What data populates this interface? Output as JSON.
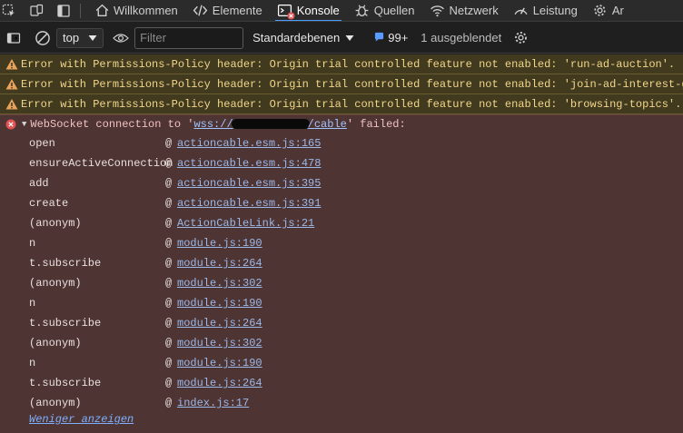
{
  "tabs": [
    {
      "label": "Willkommen",
      "icon": "home-icon"
    },
    {
      "label": "Elemente",
      "icon": "code-icon"
    },
    {
      "label": "Konsole",
      "icon": "console-icon",
      "active": true
    },
    {
      "label": "Quellen",
      "icon": "bug-icon"
    },
    {
      "label": "Netzwerk",
      "icon": "wifi-icon"
    },
    {
      "label": "Leistung",
      "icon": "performance-icon"
    },
    {
      "label": "Ar",
      "icon": "gear-icon"
    }
  ],
  "toolbar": {
    "context": "top",
    "filter_placeholder": "Filter",
    "levels": "Standardebenen",
    "issues_count": "99+",
    "hidden": "1 ausgeblendet"
  },
  "warnings": [
    "Error with Permissions-Policy header: Origin trial controlled feature not enabled: 'run-ad-auction'.",
    "Error with Permissions-Policy header: Origin trial controlled feature not enabled: 'join-ad-interest-group'.",
    "Error with Permissions-Policy header: Origin trial controlled feature not enabled: 'browsing-topics'."
  ],
  "error": {
    "prefix": "WebSocket connection to '",
    "url_start": "wss://",
    "url_end": "/cable",
    "suffix": "' failed:"
  },
  "stack": [
    {
      "fn": "open",
      "loc": "actioncable.esm.js:165"
    },
    {
      "fn": "ensureActiveConnection",
      "loc": "actioncable.esm.js:478"
    },
    {
      "fn": "add",
      "loc": "actioncable.esm.js:395"
    },
    {
      "fn": "create",
      "loc": "actioncable.esm.js:391"
    },
    {
      "fn": "(anonym)",
      "loc": "ActionCableLink.js:21"
    },
    {
      "fn": "n",
      "loc": "module.js:190"
    },
    {
      "fn": "t.subscribe",
      "loc": "module.js:264"
    },
    {
      "fn": "(anonym)",
      "loc": "module.js:302"
    },
    {
      "fn": "n",
      "loc": "module.js:190"
    },
    {
      "fn": "t.subscribe",
      "loc": "module.js:264"
    },
    {
      "fn": "(anonym)",
      "loc": "module.js:302"
    },
    {
      "fn": "n",
      "loc": "module.js:190"
    },
    {
      "fn": "t.subscribe",
      "loc": "module.js:264"
    },
    {
      "fn": "(anonym)",
      "loc": "index.js:17"
    }
  ],
  "at_symbol": "@",
  "show_less": "Weniger anzeigen",
  "colors": {
    "accent": "#4a9eff",
    "warning_bg": "#413a1f",
    "error_bg": "#4e3534",
    "error_icon": "#e05252"
  }
}
